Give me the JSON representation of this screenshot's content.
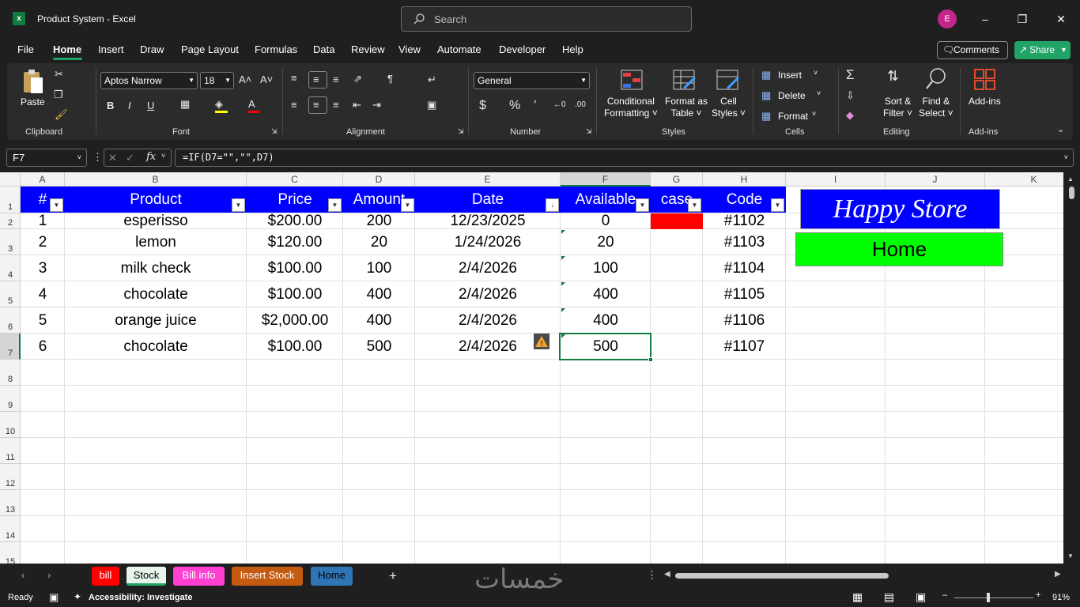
{
  "window": {
    "title": "Product System  -  Excel",
    "search_placeholder": "Search",
    "avatar_initial": "E"
  },
  "menu": {
    "items": [
      "File",
      "Home",
      "Insert",
      "Draw",
      "Page Layout",
      "Formulas",
      "Data",
      "Review",
      "View",
      "Automate",
      "Developer",
      "Help"
    ],
    "active": "Home",
    "comments_label": "Comments",
    "share_label": "Share"
  },
  "ribbon": {
    "clipboard": {
      "paste_label": "Paste",
      "group_label": "Clipboard"
    },
    "font": {
      "font_name": "Aptos Narrow",
      "font_size": "18",
      "group_label": "Font"
    },
    "alignment": {
      "group_label": "Alignment"
    },
    "number": {
      "format": "General",
      "group_label": "Number"
    },
    "styles": {
      "conditional_formatting": [
        "Conditional",
        "Formatting"
      ],
      "format_as_table": [
        "Format as",
        "Table"
      ],
      "cell_styles": [
        "Cell",
        "Styles"
      ],
      "group_label": "Styles"
    },
    "cells": {
      "insert": "Insert",
      "delete": "Delete",
      "format": "Format",
      "group_label": "Cells"
    },
    "editing": {
      "sort_filter": [
        "Sort &",
        "Filter"
      ],
      "find_select": [
        "Find &",
        "Select"
      ],
      "group_label": "Editing"
    },
    "addins": {
      "label": "Add-ins",
      "group_label": "Add-ins"
    }
  },
  "formula_bar": {
    "name_box": "F7",
    "formula": "=IF(D7=\"\",\"\",D7)"
  },
  "columns": [
    "A",
    "B",
    "C",
    "D",
    "E",
    "F",
    "G",
    "H",
    "I",
    "J",
    "K"
  ],
  "rows": [
    "1",
    "2",
    "3",
    "4",
    "5",
    "6",
    "7",
    "8",
    "9",
    "10",
    "11",
    "12",
    "13",
    "14",
    "15"
  ],
  "table": {
    "headers": [
      "#",
      "Product",
      "Price",
      "Amount",
      "Date",
      "Available",
      "case",
      "Code"
    ],
    "rows": [
      [
        "1",
        "esperisso",
        "$200.00",
        "200",
        "12/23/2025",
        "0",
        "",
        "#1102"
      ],
      [
        "2",
        "lemon",
        "$120.00",
        "20",
        "1/24/2026",
        "20",
        "",
        "#1103"
      ],
      [
        "3",
        "milk check",
        "$100.00",
        "100",
        "2/4/2026",
        "100",
        "",
        "#1104"
      ],
      [
        "4",
        "chocolate",
        "$100.00",
        "400",
        "2/4/2026",
        "400",
        "",
        "#1105"
      ],
      [
        "5",
        "orange juice",
        "$2,000.00",
        "400",
        "2/4/2026",
        "400",
        "",
        "#1106"
      ],
      [
        "6",
        "chocolate",
        "$100.00",
        "500",
        "2/4/2026",
        "500",
        "",
        "#1107"
      ]
    ],
    "header_bg": "#0000ff",
    "alert_fill": "#ff0000"
  },
  "shapes": {
    "happy_store": "Happy Store",
    "home_button": "Home",
    "happy_store_bg": "#0000ff",
    "home_bg": "#00ff00"
  },
  "sheet_tabs": [
    {
      "name": "bill",
      "color": "#ff0000"
    },
    {
      "name": "Stock",
      "color": "active"
    },
    {
      "name": "Bill info",
      "color": "#ff3fd0"
    },
    {
      "name": "Insert Stock",
      "color": "#c55a11"
    },
    {
      "name": "Home",
      "color": "#2e75b6"
    }
  ],
  "status": {
    "ready": "Ready",
    "accessibility": "Accessibility: Investigate",
    "zoom": "91%",
    "watermark": "خمسات"
  }
}
